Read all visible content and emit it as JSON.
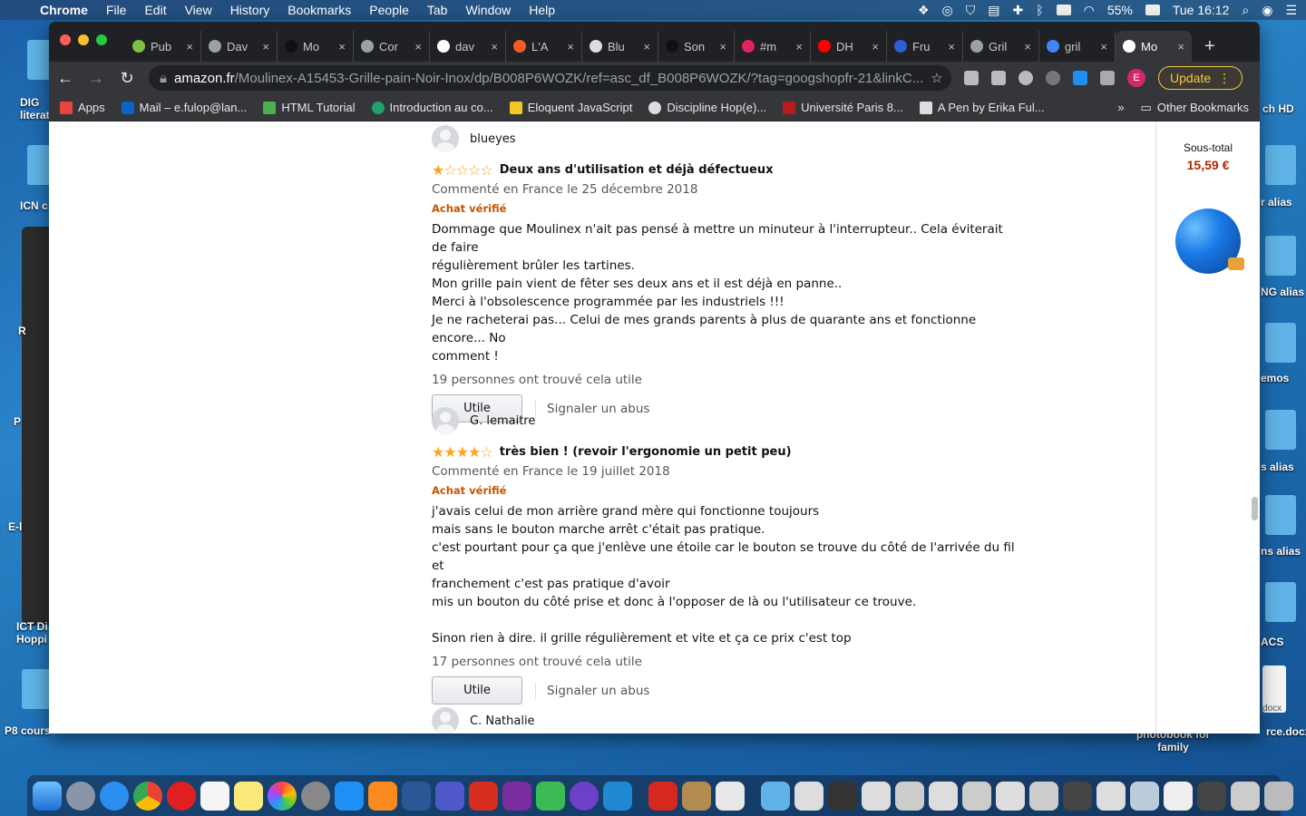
{
  "menubar": {
    "app": "Chrome",
    "items": [
      "File",
      "Edit",
      "View",
      "History",
      "Bookmarks",
      "People",
      "Tab",
      "Window",
      "Help"
    ],
    "battery": "55%",
    "clock": "Tue 16:12"
  },
  "desktop": {
    "left_labels": [
      "DIG literat",
      "ICN c",
      "R",
      "P",
      "E-l",
      "ICT Di Hoppi",
      "P8 cours"
    ],
    "right_labels": [
      "ch HD",
      "r alias",
      "NG alias",
      "emos",
      "s alias",
      "ns alias",
      "ACS",
      "docx",
      "photobook for family",
      "rce.docx"
    ]
  },
  "browser": {
    "tabs": [
      {
        "title": "Pub",
        "color": "#7cc142"
      },
      {
        "title": "Dav",
        "color": "#9aa0a6"
      },
      {
        "title": "Mo",
        "color": "#111111"
      },
      {
        "title": "Cor",
        "color": "#9aa0a6"
      },
      {
        "title": "dav",
        "color": "#ffffff"
      },
      {
        "title": "L'A",
        "color": "#f25b22"
      },
      {
        "title": "Blu",
        "color": "#dddddd"
      },
      {
        "title": "Son",
        "color": "#111111"
      },
      {
        "title": "#m",
        "color": "#e0245e"
      },
      {
        "title": "DH",
        "color": "#ff0000"
      },
      {
        "title": "Fru",
        "color": "#2c5fd4"
      },
      {
        "title": "Gril",
        "color": "#9aa0a6"
      },
      {
        "title": "gril",
        "color": "#4285f4"
      },
      {
        "title": "Mo",
        "color": "#ffffff",
        "active": true
      }
    ],
    "url_host": "amazon.fr",
    "url_path": "/Moulinex-A15453-Grille-pain-Noir-Inox/dp/B008P6WOZK/ref=asc_df_B008P6WOZK/?tag=googshopfr-21&linkC...",
    "profile_initial": "E",
    "update_label": "Update",
    "bookmarks": [
      {
        "label": "Apps",
        "color": "#e8453c"
      },
      {
        "label": "Mail – e.fulop@lan...",
        "color": "#0a64c8"
      },
      {
        "label": "HTML Tutorial",
        "color": "#4caf50"
      },
      {
        "label": "Introduction au co...",
        "color": "#22a06b"
      },
      {
        "label": "Eloquent JavaScript",
        "color": "#f3c623"
      },
      {
        "label": "Discipline Hop(e)...",
        "color": "#dddddd"
      },
      {
        "label": "Université Paris 8...",
        "color": "#b71c1c"
      },
      {
        "label": "A Pen by Erika Ful...",
        "color": "#dddddd"
      }
    ],
    "bookmarks_more": "»",
    "other_bookmarks": "Other Bookmarks"
  },
  "page": {
    "reviews": [
      {
        "author": "blueyes",
        "stars_filled": 1,
        "stars_total": 5,
        "title": "Deux ans d'utilisation et déjà défectueux",
        "date": "Commenté en France le 25 décembre 2018",
        "verified": "Achat vérifié",
        "body": [
          "Dommage que Moulinex n'ait pas pensé à mettre un minuteur à l'interrupteur.. Cela éviterait de faire",
          "régulièrement brûler les tartines.",
          "Mon grille pain vient de fêter ses deux ans et il est déjà en panne..",
          "Merci à l'obsolescence programmée par les industriels !!!",
          "Je ne racheterai pas... Celui de mes grands parents à plus de quarante ans et fonctionne encore... No",
          "comment !"
        ],
        "helpful": "19 personnes ont trouvé cela utile",
        "button": "Utile",
        "report": "Signaler un abus"
      },
      {
        "author": "G. lemaitre",
        "stars_filled": 4,
        "stars_total": 5,
        "title": "très bien ! (revoir l'ergonomie un petit peu)",
        "date": "Commenté en France le 19 juillet 2018",
        "verified": "Achat vérifié",
        "body": [
          "j'avais celui de mon arrière grand mère qui fonctionne toujours",
          "mais sans le bouton marche arrêt c'était pas pratique.",
          "c'est pourtant pour ça que j'enlève une étoile car le bouton se trouve du côté de l'arrivée du fil et",
          "franchement c'est pas pratique d'avoir",
          "mis un bouton du côté prise et donc à l'opposer de là ou l'utilisateur ce trouve.",
          "",
          "Sinon rien à dire. il grille régulièrement et vite et ça ce prix c'est top"
        ],
        "helpful": "17 personnes ont trouvé cela utile",
        "button": "Utile",
        "report": "Signaler un abus"
      },
      {
        "author": "C. Nathalie"
      }
    ],
    "cart": {
      "subtotal_label": "Sous-total",
      "subtotal_value": "15,59 €"
    }
  }
}
